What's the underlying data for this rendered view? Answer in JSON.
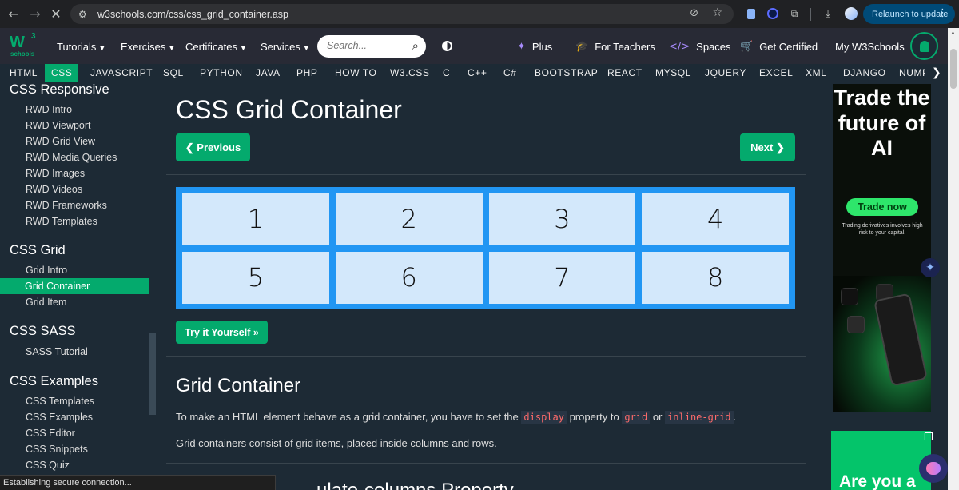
{
  "browser": {
    "url": "w3schools.com/css/css_grid_container.asp",
    "relaunch_label": "Relaunch to update",
    "status": "Establishing secure connection..."
  },
  "topnav": {
    "logo_main": "W",
    "logo_sup": "3",
    "logo_sub": "schools",
    "items": [
      {
        "label": "Tutorials"
      },
      {
        "label": "Exercises"
      },
      {
        "label": "Certificates"
      },
      {
        "label": "Services"
      }
    ],
    "search_placeholder": "Search...",
    "right": {
      "plus": "Plus",
      "teachers": "For Teachers",
      "spaces": "Spaces",
      "certified": "Get Certified",
      "my": "My W3Schools"
    }
  },
  "subnav": [
    "HTML",
    "CSS",
    "JAVASCRIPT",
    "SQL",
    "PYTHON",
    "JAVA",
    "PHP",
    "HOW TO",
    "W3.CSS",
    "C",
    "C++",
    "C#",
    "BOOTSTRAP",
    "REACT",
    "MYSQL",
    "JQUERY",
    "EXCEL",
    "XML",
    "DJANGO",
    "NUMPY"
  ],
  "sidebar": {
    "sections": [
      {
        "heading": "CSS Responsive",
        "links": [
          "RWD Intro",
          "RWD Viewport",
          "RWD Grid View",
          "RWD Media Queries",
          "RWD Images",
          "RWD Videos",
          "RWD Frameworks",
          "RWD Templates"
        ]
      },
      {
        "heading": "CSS Grid",
        "links": [
          "Grid Intro",
          "Grid Container",
          "Grid Item"
        ]
      },
      {
        "heading": "CSS SASS",
        "links": [
          "SASS Tutorial"
        ]
      },
      {
        "heading": "CSS Examples",
        "links": [
          "CSS Templates",
          "CSS Examples",
          "CSS Editor",
          "CSS Snippets",
          "CSS Quiz"
        ]
      }
    ]
  },
  "main": {
    "title": "CSS Grid Container",
    "prev_label": "❮ Previous",
    "next_label": "Next ❯",
    "grid_items": [
      "1",
      "2",
      "3",
      "4",
      "5",
      "6",
      "7",
      "8"
    ],
    "try_label": "Try it Yourself »",
    "h2": "Grid Container",
    "p1_before": "To make an HTML element behave as a grid container, you have to set the ",
    "p1_code1": "display",
    "p1_mid": " property to ",
    "p1_code2": "grid",
    "p1_or": " or ",
    "p1_code3": "inline-grid",
    "p1_end": ".",
    "p2": "Grid containers consist of grid items, placed inside columns and rows.",
    "next_heading_cut": "...ulate-columns Property"
  },
  "ads": {
    "ad1_headline": "Trade the future of AI",
    "ad1_cta": "Trade now",
    "ad1_small": "Trading derivatives involves high risk to your capital.",
    "ad2_text": "Are you a"
  },
  "colors": {
    "accent": "#04aa6d",
    "bg": "#1d2a35",
    "grid_border": "#2196f3",
    "grid_item": "#d3e8fb"
  }
}
